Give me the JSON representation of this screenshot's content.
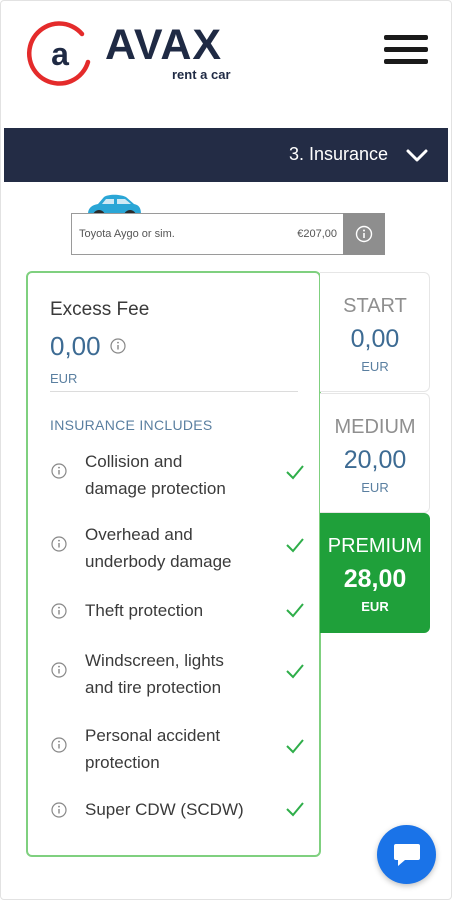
{
  "header": {
    "brand": "AVAX",
    "tagline": "rent a car",
    "logo_letter": "a",
    "menu_icon": "hamburger-menu-icon"
  },
  "step_bar": {
    "label": "3. Insurance",
    "icon": "chevron-down-icon"
  },
  "car": {
    "name": "Toyota Aygo or sim.",
    "price": "€207,00",
    "icon": "info-icon"
  },
  "insurance": {
    "excess_title": "Excess Fee",
    "excess_value": "0,00",
    "excess_currency": "EUR",
    "includes_title": "INSURANCE INCLUDES",
    "features": [
      {
        "line1": "Collision and",
        "line2": "damage protection"
      },
      {
        "line1": "Overhead and",
        "line2": "underbody damage"
      },
      {
        "line1": "Theft protection",
        "line2": ""
      },
      {
        "line1": "Windscreen, lights",
        "line2": "and tire protection"
      },
      {
        "line1": "Personal accident",
        "line2": "protection"
      },
      {
        "line1": "Super CDW (SCDW)",
        "line2": ""
      }
    ]
  },
  "tiers": [
    {
      "name": "START",
      "price": "0,00",
      "currency": "EUR"
    },
    {
      "name": "MEDIUM",
      "price": "20,00",
      "currency": "EUR"
    },
    {
      "name": "PREMIUM",
      "price": "28,00",
      "currency": "EUR",
      "selected": true
    }
  ],
  "colors": {
    "navy": "#232c45",
    "brand_red": "#e42b2b",
    "selected_green": "#1fa03a",
    "card_border_green": "#7fd07f",
    "check_green": "#2fae4a",
    "value_blue": "#3d6b93",
    "chat_blue": "#1a73e8"
  },
  "chat": {
    "icon": "chat-bubble-icon"
  }
}
